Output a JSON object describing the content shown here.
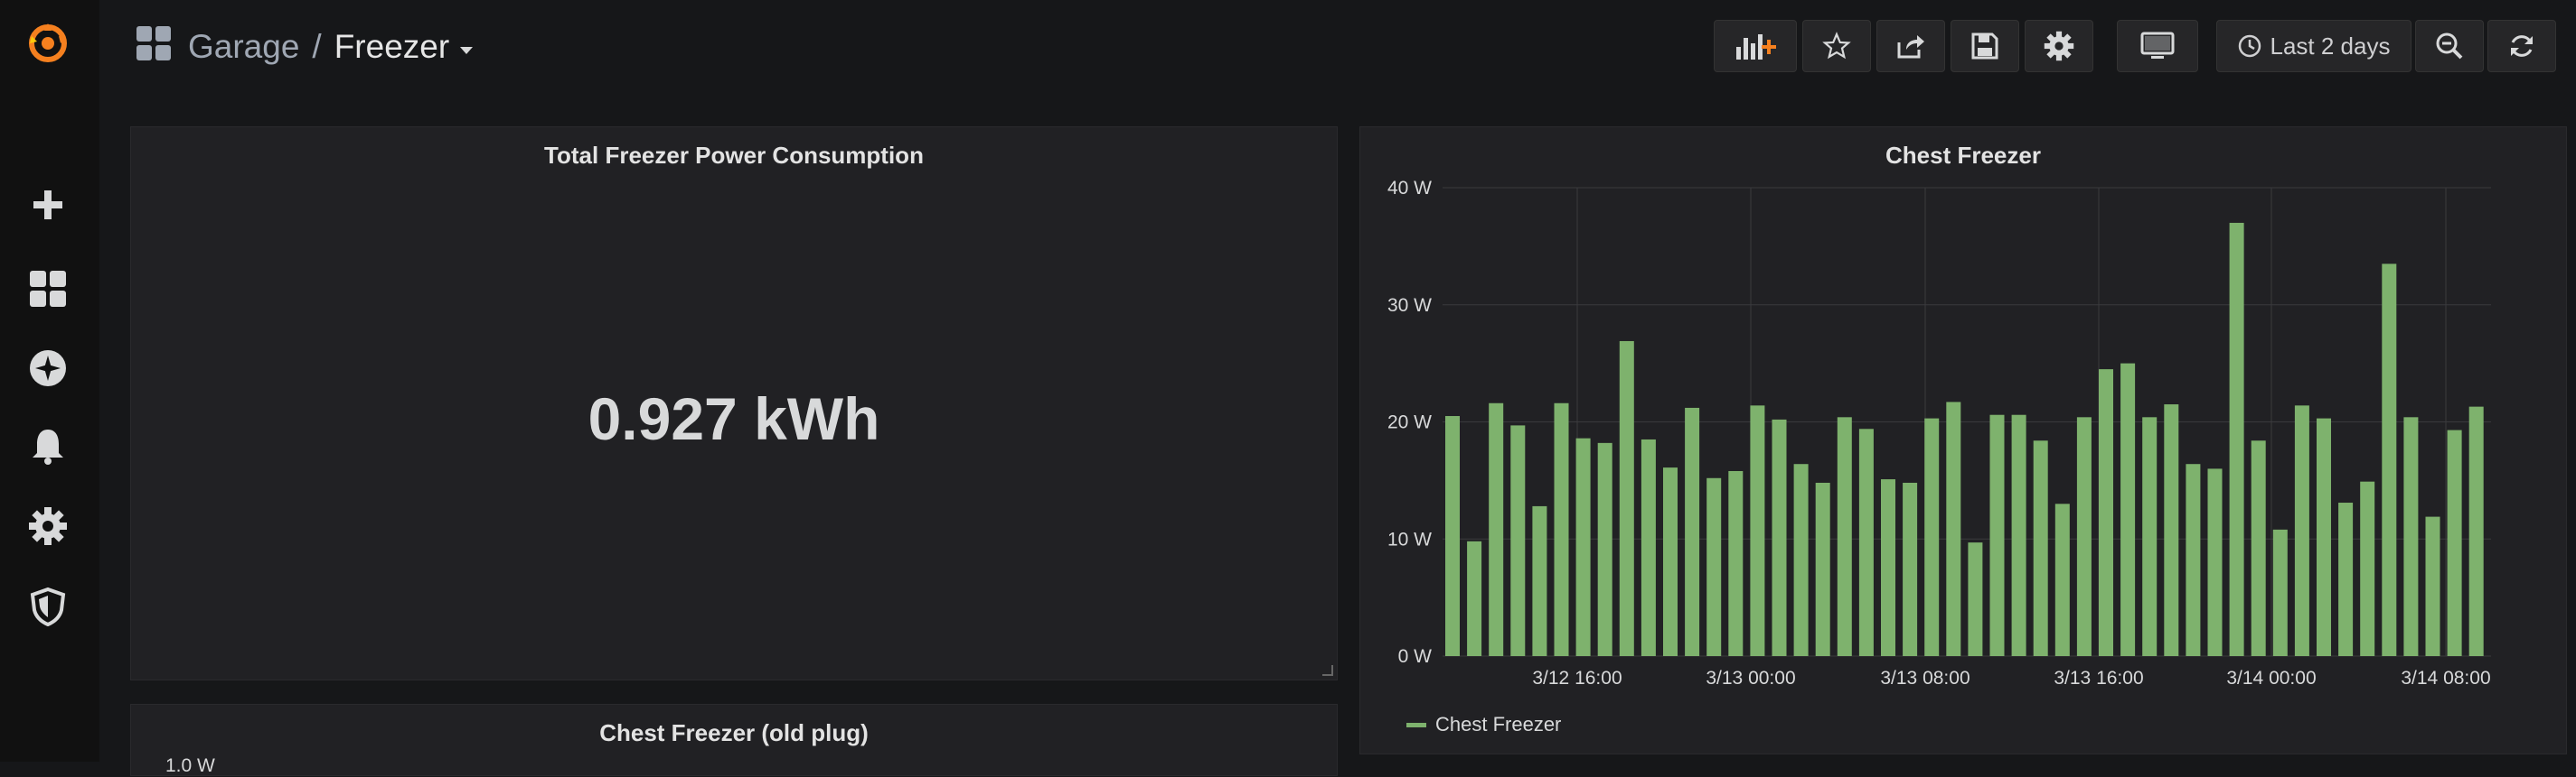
{
  "breadcrumb": {
    "parent": "Garage",
    "separator": "/",
    "current": "Freezer"
  },
  "toolbar": {
    "time_range": "Last 2 days"
  },
  "sidebar": {
    "items": [
      {
        "icon": "grafana-logo-icon"
      },
      {
        "icon": "plus-icon"
      },
      {
        "icon": "dashboards-icon"
      },
      {
        "icon": "explore-compass-icon"
      },
      {
        "icon": "bell-icon"
      },
      {
        "icon": "gear-icon"
      },
      {
        "icon": "shield-icon"
      }
    ]
  },
  "panels": {
    "total": {
      "title": "Total Freezer Power Consumption",
      "value": "0.927 kWh"
    },
    "chest": {
      "title": "Chest Freezer",
      "legend": "Chest Freezer"
    },
    "old_plug": {
      "title": "Chest Freezer (old plug)",
      "partial_ytick": "1.0 W"
    }
  },
  "colors": {
    "accent": "#f5801f",
    "series": "#7eb26d",
    "panel_bg": "#212124"
  },
  "chart_data": {
    "type": "bar",
    "title": "Chest Freezer",
    "ylim": [
      0,
      40
    ],
    "y_ticks": [
      "0 W",
      "10 W",
      "20 W",
      "30 W",
      "40 W"
    ],
    "x_ticks": [
      "3/12 16:00",
      "3/13 00:00",
      "3/13 08:00",
      "3/13 16:00",
      "3/14 00:00",
      "3/14 08:00"
    ],
    "grid": true,
    "legend_placement": "bottom-left",
    "series": [
      {
        "name": "Chest Freezer",
        "values": [
          20.5,
          9.8,
          21.6,
          19.7,
          12.8,
          21.6,
          18.6,
          18.2,
          26.9,
          18.5,
          16.1,
          21.2,
          15.2,
          15.8,
          21.4,
          20.2,
          16.4,
          14.8,
          20.4,
          19.4,
          15.1,
          14.8,
          20.3,
          21.7,
          9.7,
          20.6,
          20.6,
          18.4,
          13.0,
          20.4,
          24.5,
          25.0,
          20.4,
          21.5,
          16.4,
          16.0,
          37.0,
          18.4,
          10.8,
          21.4,
          20.3,
          13.1,
          14.9,
          33.5,
          20.4,
          11.9,
          19.3,
          21.3
        ]
      }
    ]
  }
}
